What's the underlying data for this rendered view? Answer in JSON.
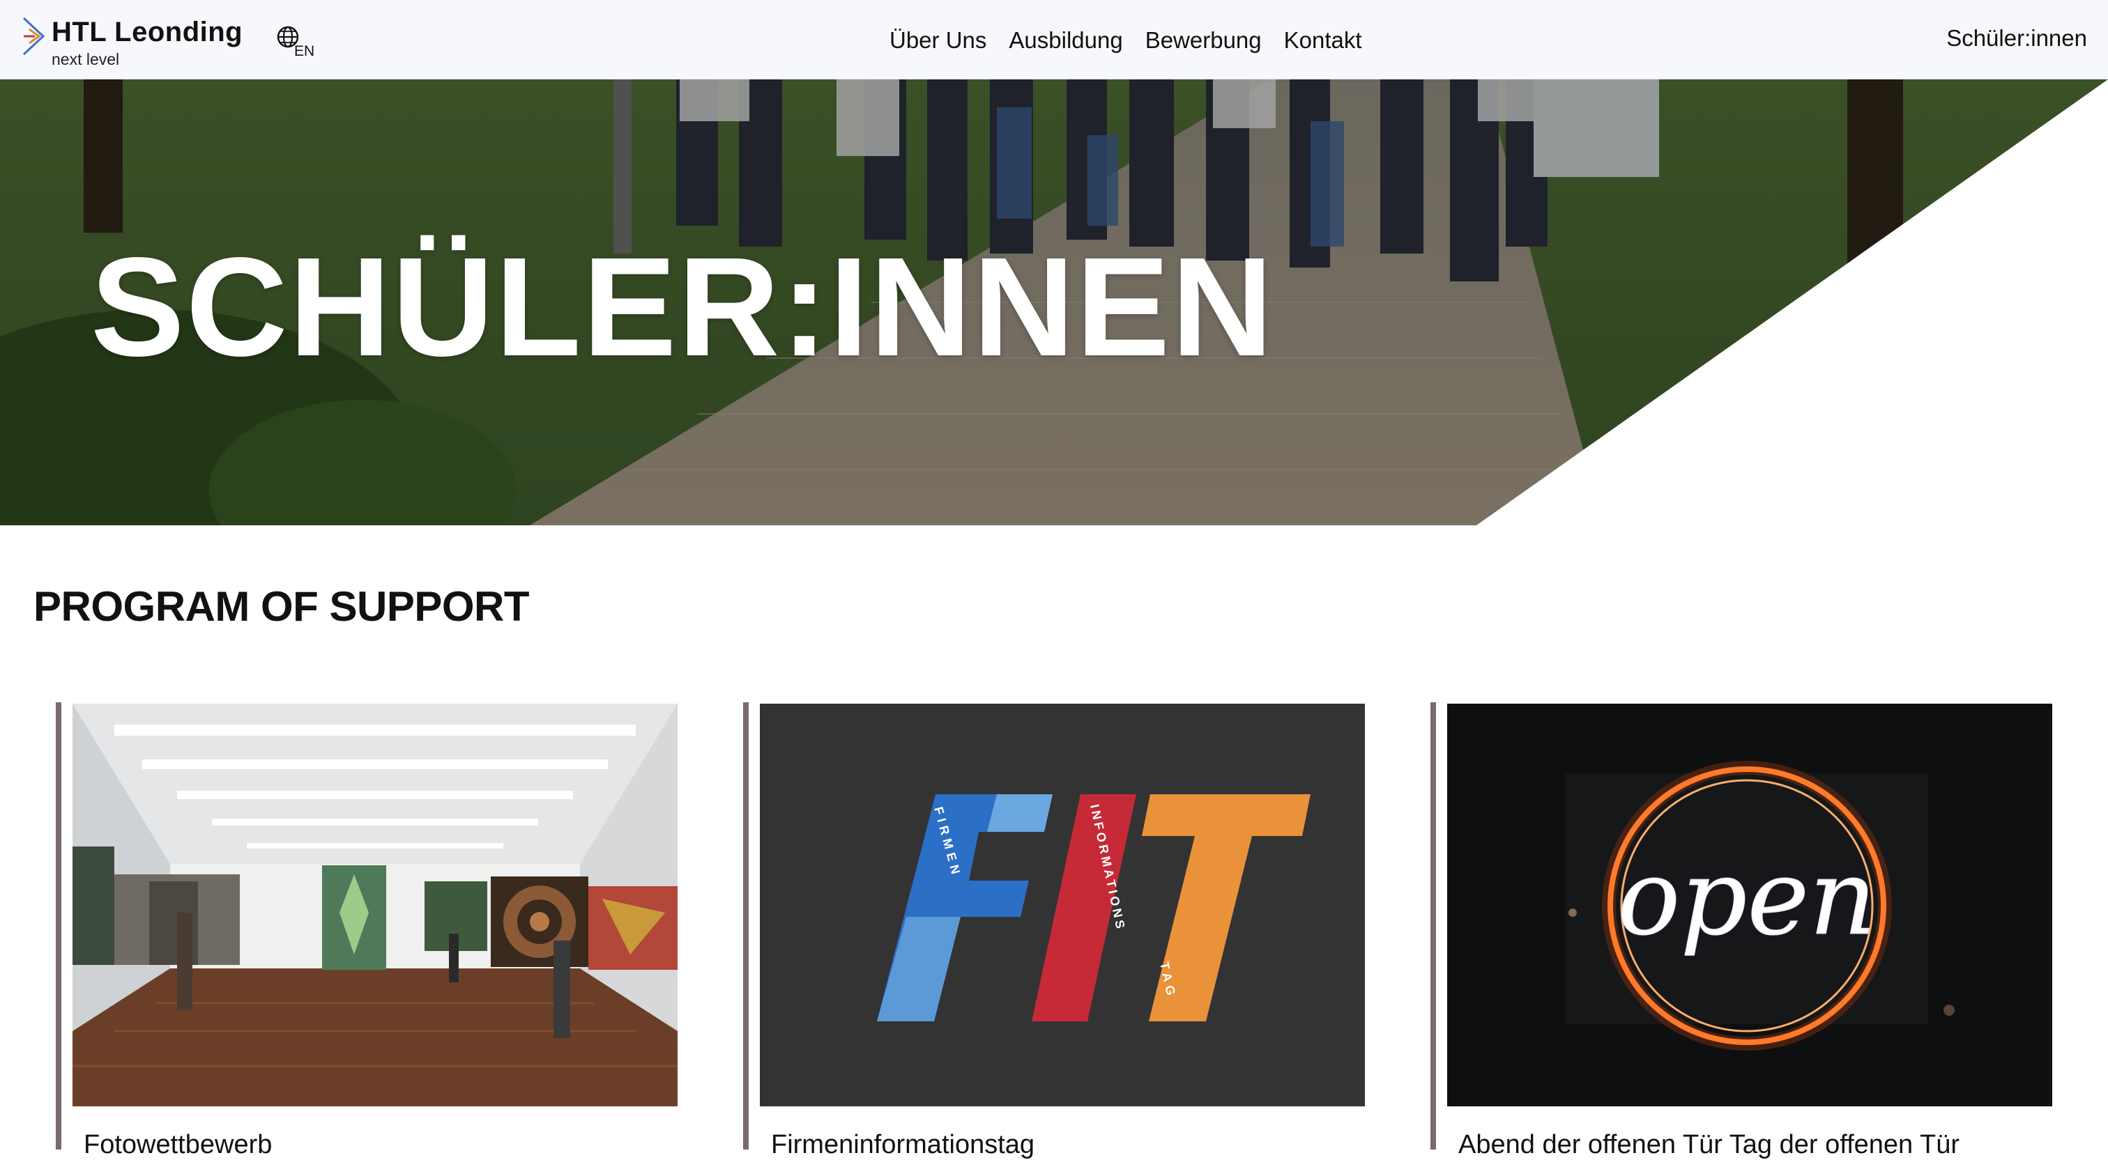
{
  "header": {
    "logo_title": "HTL Leonding",
    "logo_subtitle": "next level",
    "language_label": "EN",
    "nav_items": [
      {
        "label": "Über Uns"
      },
      {
        "label": "Ausbildung"
      },
      {
        "label": "Bewerbung"
      },
      {
        "label": "Kontakt"
      }
    ],
    "right_link": "Schüler:innen"
  },
  "hero": {
    "title": "SCHÜLER:INNEN"
  },
  "section": {
    "title": "PROGRAM OF SUPPORT"
  },
  "cards": [
    {
      "title": "Fotowettbewerb"
    },
    {
      "title": "Firmeninformationstag"
    },
    {
      "title": "Abend der offenen Tür Tag der offenen Tür"
    }
  ],
  "fit_logo": {
    "letters": [
      "F",
      "I",
      "T"
    ],
    "words": [
      "FIRMEN",
      "INFORMATIONS",
      "TAG"
    ]
  },
  "neon_sign": {
    "text": "open"
  },
  "colors": {
    "header_bg": "#f7f8fb",
    "card_bar": "#7b6a6b",
    "fit_blue": "#2c6fc6",
    "fit_red": "#c52a36",
    "fit_orange": "#ea923a",
    "neon_orange": "#ff7a2a"
  }
}
